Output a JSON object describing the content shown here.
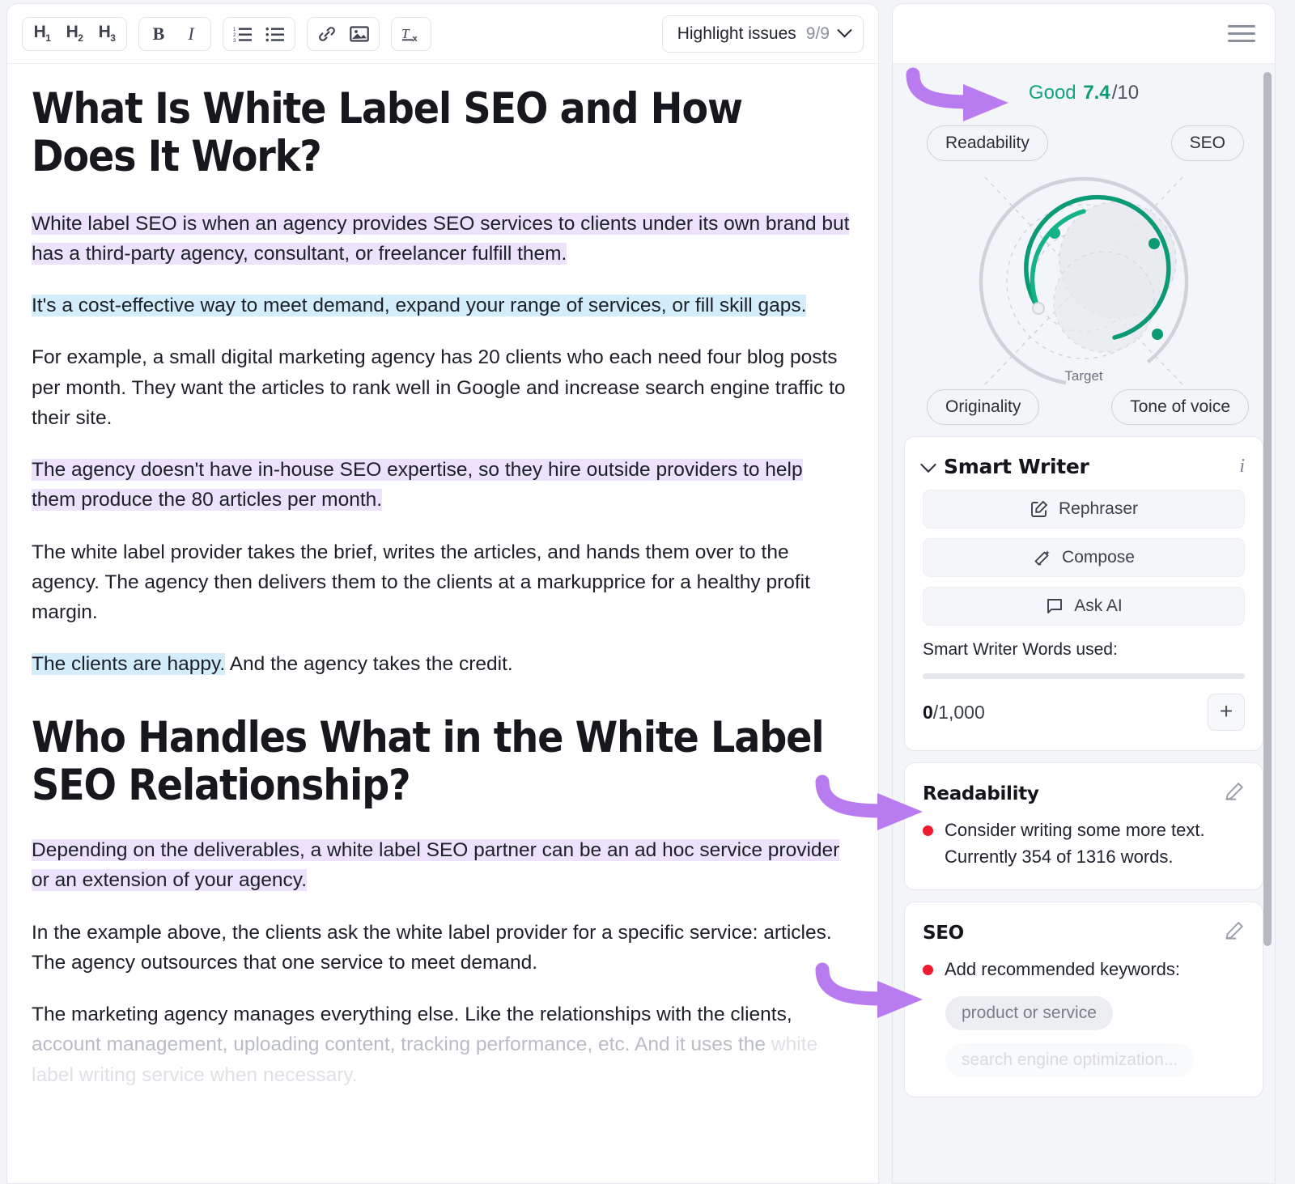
{
  "toolbar": {
    "groups": [
      {
        "name": "headings",
        "buttons": [
          {
            "icon": "h1-icon",
            "label": "H",
            "sub": "1"
          },
          {
            "icon": "h2-icon",
            "label": "H",
            "sub": "2"
          },
          {
            "icon": "h3-icon",
            "label": "H",
            "sub": "3"
          }
        ]
      },
      {
        "name": "format",
        "buttons": [
          {
            "icon": "bold-icon",
            "label": "B"
          },
          {
            "icon": "italic-icon",
            "label": "I"
          }
        ]
      },
      {
        "name": "lists",
        "buttons": [
          {
            "icon": "ordered-list-icon",
            "label": ""
          },
          {
            "icon": "bullet-list-icon",
            "label": ""
          }
        ]
      },
      {
        "name": "insert",
        "buttons": [
          {
            "icon": "link-icon",
            "label": ""
          },
          {
            "icon": "image-icon",
            "label": ""
          }
        ]
      },
      {
        "name": "clear",
        "buttons": [
          {
            "icon": "clear-format-icon",
            "label": ""
          }
        ]
      }
    ],
    "highlight_issues": {
      "label": "Highlight issues",
      "count": "9/9"
    }
  },
  "document": {
    "h1": "What Is White Label SEO and How Does It Work?",
    "paragraphs": [
      {
        "type": "highlight-purple",
        "text": "White label SEO is when an agency provides SEO services to clients under its own brand but has a third-party agency, consultant, or freelancer fulfill them."
      },
      {
        "type": "highlight-blue",
        "text": "It's a cost-effective way to meet demand, expand your range of services, or fill skill gaps."
      },
      {
        "type": "plain",
        "text": "For example, a small digital marketing agency has 20 clients who each need four blog posts per month. They want the articles to rank well in Google and increase search engine traffic to their site."
      },
      {
        "type": "highlight-purple",
        "text": "The agency doesn't have in-house SEO expertise, so they hire outside providers to help them produce the 80 articles per month."
      },
      {
        "type": "plain",
        "text": "The white label provider takes the brief, writes the articles, and hands them over to the agency. The agency then delivers them to the clients at a markupprice for a healthy profit margin."
      },
      {
        "type": "mixed-blue-lead",
        "lead": "The clients are happy.",
        "rest": " And the agency takes the credit."
      }
    ],
    "h2": "Who Handles What in the White Label SEO Relationship?",
    "paragraphs2": [
      {
        "type": "highlight-purple",
        "text": "Depending on the deliverables, a white label SEO partner can be an ad hoc service provider or an extension of your agency."
      },
      {
        "type": "plain",
        "text": "In the example above, the clients ask the white label provider for a specific service: articles. The agency outsources that one service to meet demand."
      },
      {
        "type": "fade",
        "lead": "The marketing agency manages everything else. Like the relationships with the clients,",
        "mid": " account management, uploading content, tracking performance, etc. And it uses the",
        "tail": " white label writing service when necessary."
      }
    ]
  },
  "sidebar": {
    "menu_icon": "hamburger-menu-icon",
    "score": {
      "rating": "Good",
      "value": "7.4",
      "denominator": "/10",
      "rating_color": "#12a67c"
    },
    "radar": {
      "target_label": "Target",
      "pills": [
        {
          "name": "readability",
          "label": "Readability"
        },
        {
          "name": "seo",
          "label": "SEO"
        },
        {
          "name": "originality",
          "label": "Originality"
        },
        {
          "name": "tone",
          "label": "Tone of voice"
        }
      ]
    },
    "smart_writer": {
      "title": "Smart Writer",
      "info_icon": "info-icon",
      "collapse_icon": "chevron-down-icon",
      "buttons": [
        {
          "name": "rephraser",
          "icon": "pencil-square-icon",
          "label": "Rephraser"
        },
        {
          "name": "compose",
          "icon": "magic-wand-icon",
          "label": "Compose"
        },
        {
          "name": "ask-ai",
          "icon": "chat-bubble-icon",
          "label": "Ask AI"
        }
      ],
      "words_label": "Smart Writer Words used:",
      "used": "0",
      "total": "/1,000",
      "progress_percent": 0,
      "add_button": "+"
    },
    "readability_card": {
      "title": "Readability",
      "edit_icon": "pencil-icon",
      "issues": [
        {
          "severity_color": "#ee1b2e",
          "text": "Consider writing some more text. Currently 354 of 1316 words."
        }
      ]
    },
    "seo_card": {
      "title": "SEO",
      "edit_icon": "pencil-icon",
      "issues": [
        {
          "severity_color": "#ee1b2e",
          "text": "Add recommended keywords:"
        }
      ],
      "keywords": [
        {
          "label": "product or service",
          "faded": false
        },
        {
          "label": "search engine optimization...",
          "faded": true
        }
      ]
    }
  },
  "annotations": {
    "arrow_color": "#b87cf0",
    "arrows": [
      {
        "name": "arrow-to-score",
        "target": "score-row"
      },
      {
        "name": "arrow-to-readability-card",
        "target": "readability-card"
      },
      {
        "name": "arrow-to-seo-card",
        "target": "seo-card"
      }
    ]
  }
}
